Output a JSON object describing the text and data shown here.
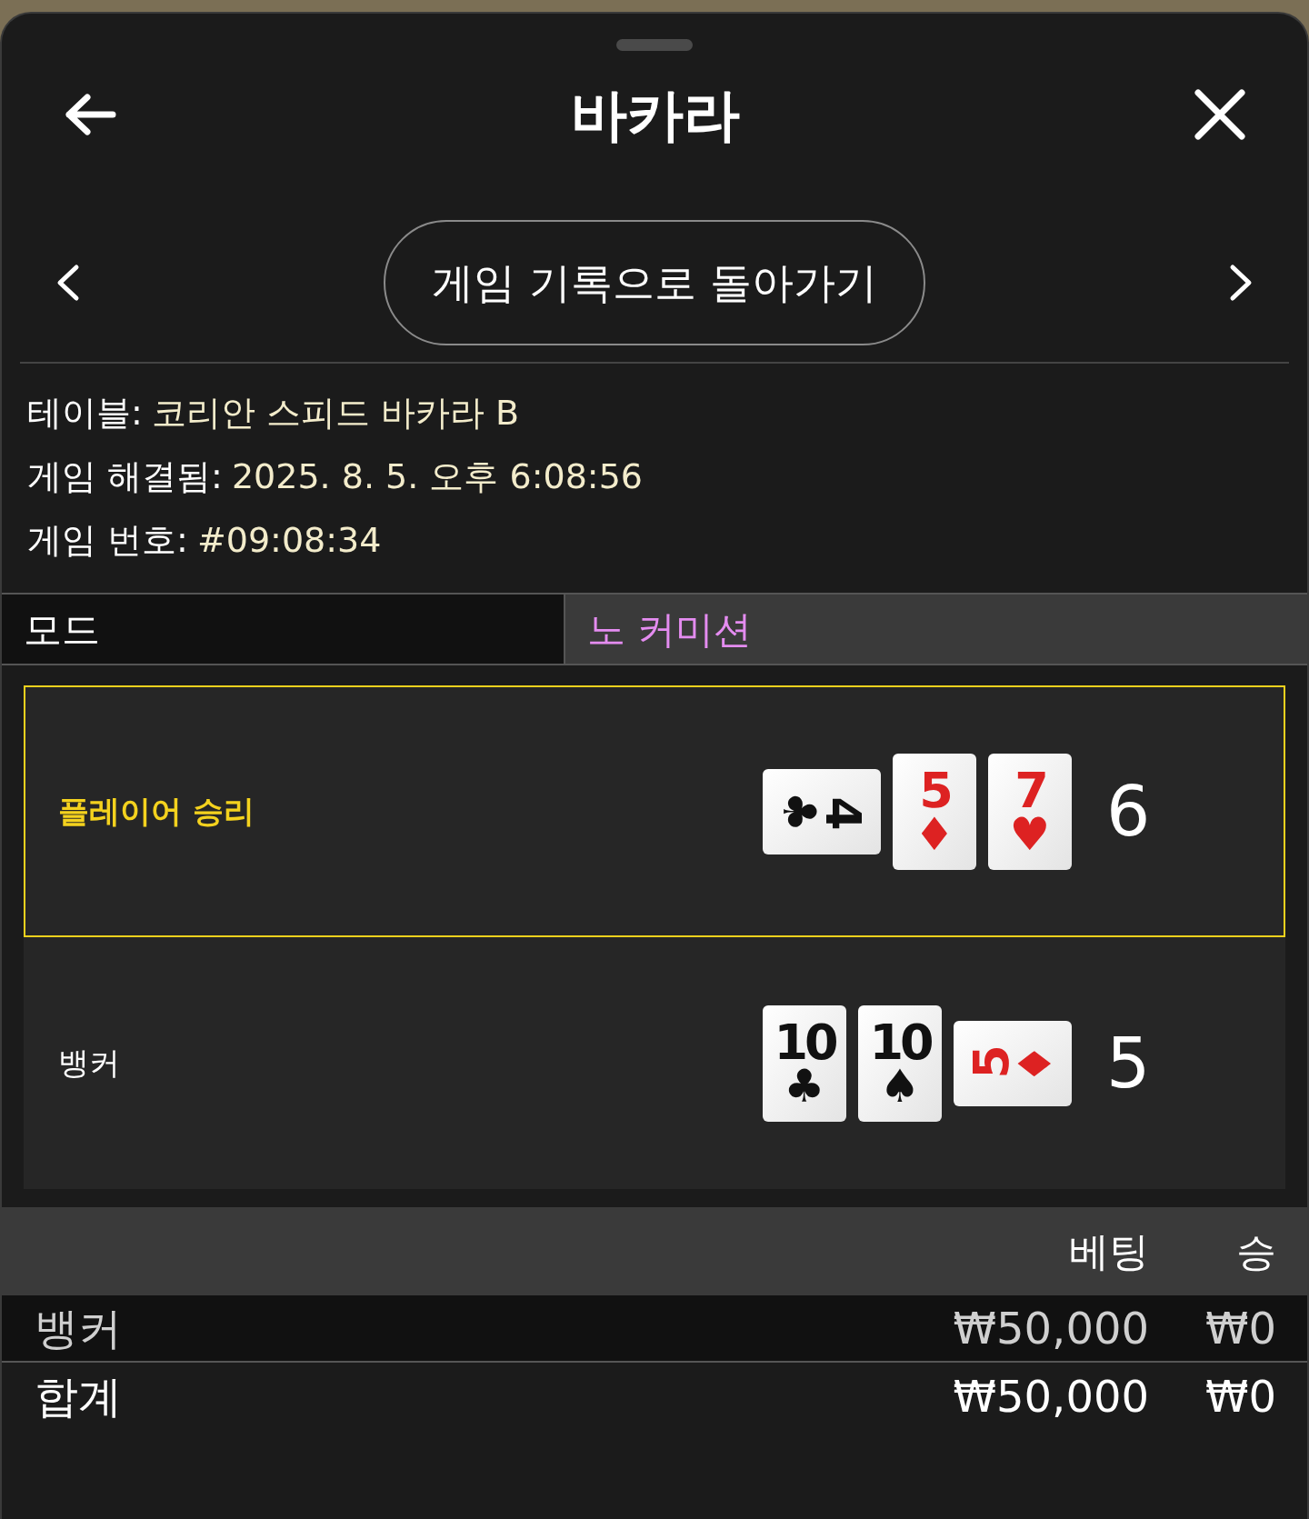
{
  "header": {
    "title": "바카라"
  },
  "history_button": "게임 기록으로 돌아가기",
  "details": [
    {
      "label": "테이블:",
      "value": "코리안 스피드 바카라 B"
    },
    {
      "label": "게임 해결됨:",
      "value": "2025. 8. 5. 오후 6:08:56"
    },
    {
      "label": "게임 번호:",
      "value": "#09:08:34"
    }
  ],
  "mode": {
    "label": "모드",
    "value": "노 커미션"
  },
  "hands": [
    {
      "label": "플레이어 승리",
      "winner": true,
      "score": "6",
      "cards": [
        {
          "rank": "4",
          "suit": "♣",
          "color": "#111111",
          "kind": "cw"
        },
        {
          "rank": "5",
          "suit": "♦",
          "color": "#dd2222",
          "kind": "upright"
        },
        {
          "rank": "7",
          "suit": "♥",
          "color": "#dd2222",
          "kind": "upright"
        }
      ]
    },
    {
      "label": "뱅커",
      "winner": false,
      "score": "5",
      "cards": [
        {
          "rank": "10",
          "suit": "♣",
          "color": "#111111",
          "kind": "upright"
        },
        {
          "rank": "10",
          "suit": "♠",
          "color": "#111111",
          "kind": "upright"
        },
        {
          "rank": "5",
          "suit": "♦",
          "color": "#dd2222",
          "kind": "ccw"
        }
      ]
    }
  ],
  "bets": {
    "columns": [
      "베팅",
      "승"
    ],
    "rows": [
      {
        "name": "뱅커",
        "bet": "₩50,000",
        "win": "₩0",
        "kind": "bet"
      },
      {
        "name": "합계",
        "bet": "₩50,000",
        "win": "₩0",
        "kind": "total"
      }
    ]
  }
}
